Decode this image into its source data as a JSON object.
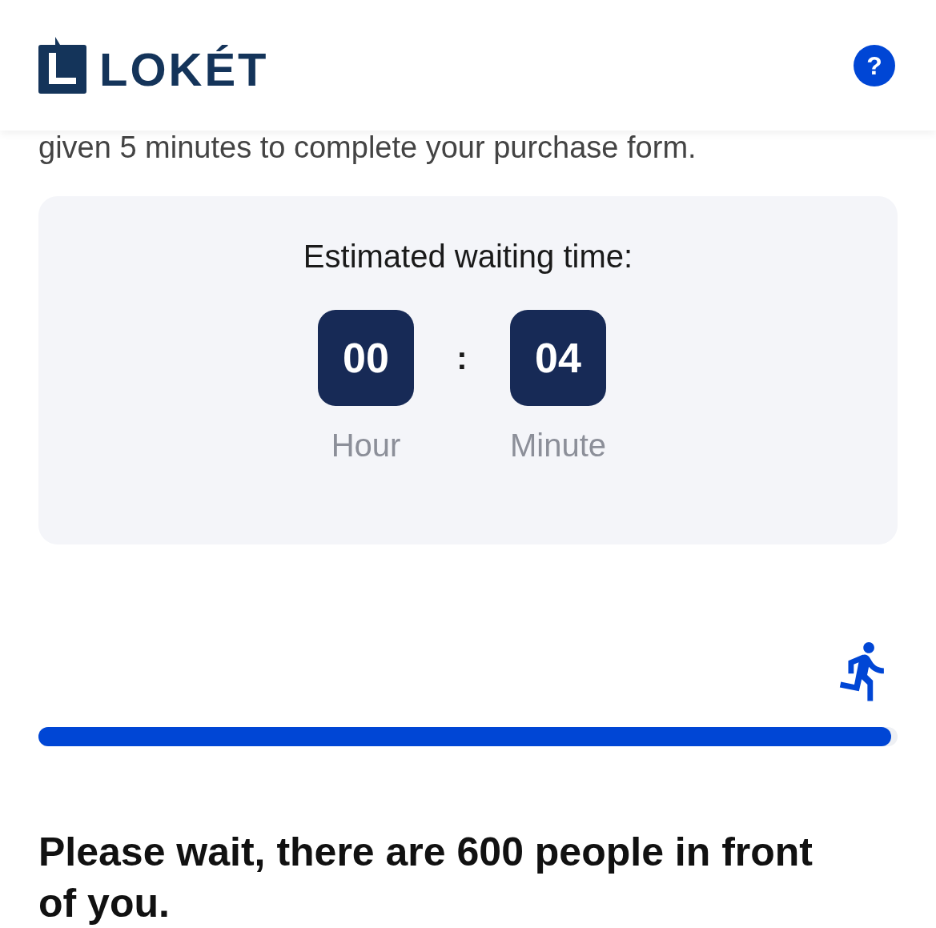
{
  "header": {
    "logo_text": "LOKÉT",
    "help_button": {
      "label": "?"
    }
  },
  "intro_text": "given 5 minutes to complete your purchase form.",
  "wait_card": {
    "title": "Estimated waiting time:",
    "units": [
      {
        "value": "00",
        "label": "Hour"
      },
      {
        "value": "04",
        "label": "Minute"
      }
    ],
    "separator": ":"
  },
  "progress": {
    "level": 0.993
  },
  "message": "Please wait, there are 600 people in front of you."
}
